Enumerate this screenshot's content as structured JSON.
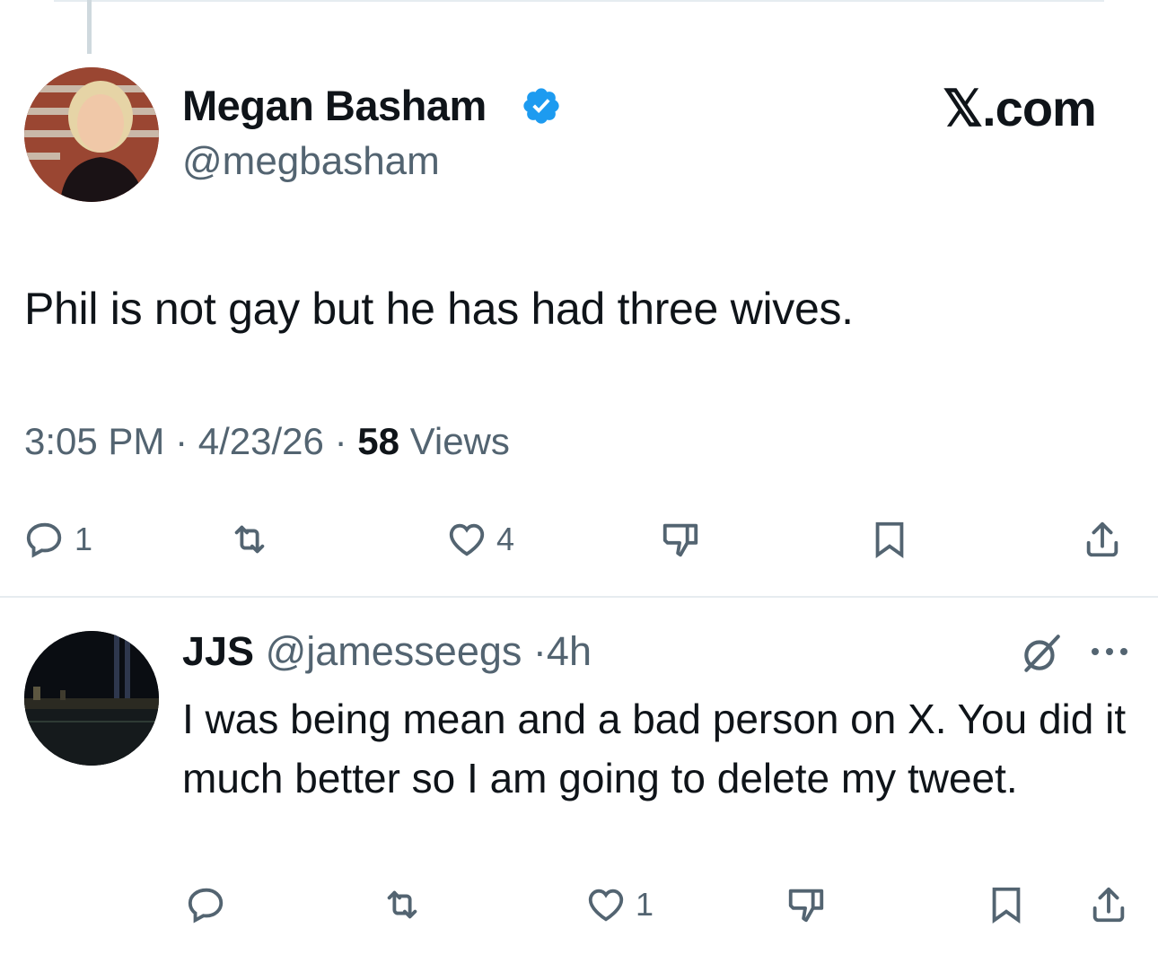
{
  "main_tweet": {
    "author_name": "Megan Basham",
    "author_handle": "@megbasham",
    "verified": true,
    "brand": "𝕏.com",
    "text": "Phil is not gay but he has had three wives.",
    "time": "3:05 PM",
    "date": "4/23/26",
    "views_count": "58",
    "views_label": "Views",
    "actions": {
      "reply_count": "1",
      "retweet_count": "",
      "like_count": "4"
    }
  },
  "reply_tweet": {
    "author_name": "JJS",
    "author_handle": "@jamesseegs",
    "age": "4h",
    "text": "I was being mean and a bad person on X.  You did it much better so I am going to delete my tweet.",
    "actions": {
      "reply_count": "",
      "retweet_count": "",
      "like_count": "1"
    }
  },
  "colors": {
    "text_primary": "#0f1419",
    "text_secondary": "#536471",
    "verified_blue": "#1d9bf0",
    "divider": "#e6ecf0"
  }
}
